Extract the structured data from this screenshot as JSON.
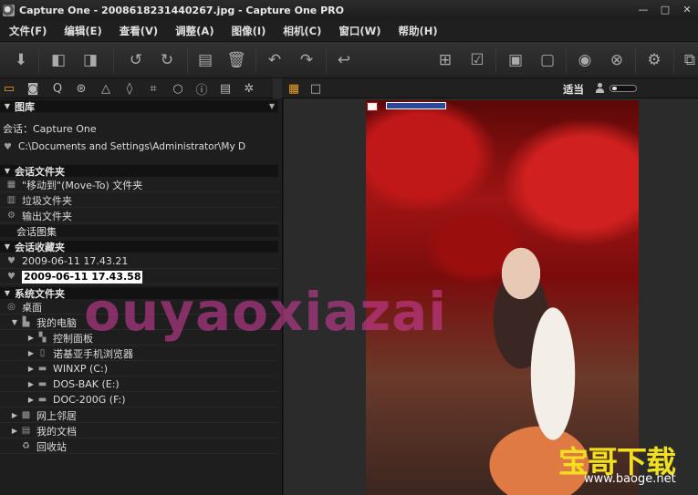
{
  "window": {
    "title": "Capture One - 2008618231440267.jpg - Capture One PRO",
    "controls": [
      "—",
      "□",
      "✕"
    ]
  },
  "menu": [
    {
      "label": "文件(F)"
    },
    {
      "label": "编辑(E)"
    },
    {
      "label": "查看(V)"
    },
    {
      "label": "调整(A)"
    },
    {
      "label": "图像(I)"
    },
    {
      "label": "相机(C)"
    },
    {
      "label": "窗口(W)"
    },
    {
      "label": "帮助(H)"
    }
  ],
  "viewer_toolbar": {
    "fit_label": "适当"
  },
  "library": {
    "header": "图库",
    "session_line": "会话：Capture One",
    "path": "C:\\Documents and Settings\\Administrator\\My D",
    "session_folders": {
      "header": "会话文件夹",
      "items": [
        "\"移动到\"(Move-To) 文件夹",
        "垃圾文件夹",
        "输出文件夹"
      ]
    },
    "session_albums": {
      "header": "会话图集"
    },
    "session_favorites": {
      "header": "会话收藏夹",
      "items": [
        "2009-06-11 17.43.21"
      ],
      "editing_value": "2009-06-11 17.43.58"
    },
    "system_folders": {
      "header": "系统文件夹",
      "desktop": "桌面",
      "my_computer": "我的电脑",
      "computer_items": [
        "控制面板",
        "诺基亚手机浏览器",
        "WINXP (C:)",
        "DOS-BAK (E:)",
        "DOC-200G (F:)"
      ],
      "network": "网上邻居",
      "my_documents": "我的文档",
      "recycle_bin": "回收站"
    }
  },
  "watermark": {
    "text": "ouyaoxiazai"
  },
  "logo": {
    "name": "宝哥下载",
    "url": "www.baoge.net"
  },
  "colors": {
    "accent": "#e8a020",
    "watermark": "#c83c96",
    "logo": "#f2e020"
  }
}
